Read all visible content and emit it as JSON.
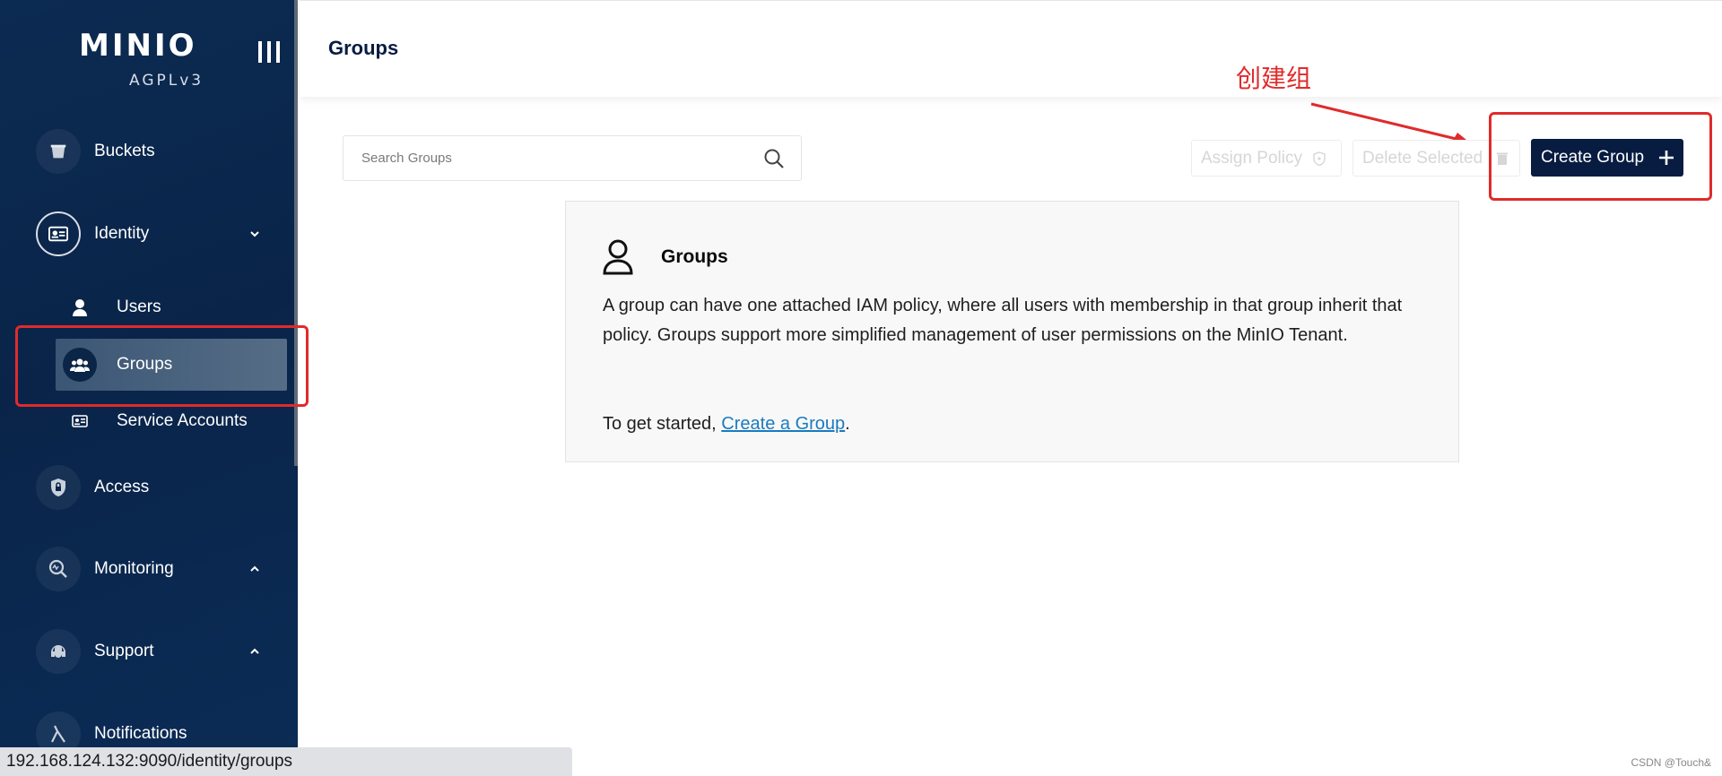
{
  "sidebar": {
    "logo": "MINIO",
    "license": "AGPLv3",
    "items": [
      {
        "label": "Buckets",
        "icon": "bucket-icon"
      },
      {
        "label": "Identity",
        "icon": "id-card-icon",
        "expanded": true
      },
      {
        "label": "Access",
        "icon": "lock-icon"
      },
      {
        "label": "Monitoring",
        "icon": "monitor-icon"
      },
      {
        "label": "Support",
        "icon": "headset-icon"
      },
      {
        "label": "Notifications",
        "icon": "lambda-icon"
      }
    ],
    "identity_subitems": [
      {
        "label": "Users",
        "icon": "user-icon"
      },
      {
        "label": "Groups",
        "icon": "groups-icon",
        "active": true
      },
      {
        "label": "Service Accounts",
        "icon": "service-account-icon"
      }
    ]
  },
  "header": {
    "title": "Groups"
  },
  "toolbar": {
    "search_placeholder": "Search Groups",
    "assign_policy": "Assign Policy",
    "delete_selected": "Delete Selected",
    "create_group": "Create Group"
  },
  "annotation": {
    "text": "创建组",
    "color": "#e02b2b"
  },
  "info_card": {
    "title": "Groups",
    "description": "A group can have one attached IAM policy, where all users with membership in that group inherit that policy. Groups support more simplified management of user permissions on the MinIO Tenant.",
    "cta_prefix": "To get started, ",
    "cta_link": "Create a Group",
    "cta_suffix": "."
  },
  "status_bar": {
    "url": "192.168.124.132:9090/identity/groups"
  },
  "watermark": "CSDN @Touch&",
  "colors": {
    "sidebar_bg": "#0a2449",
    "primary": "#081c42",
    "link": "#1a7bbf"
  }
}
